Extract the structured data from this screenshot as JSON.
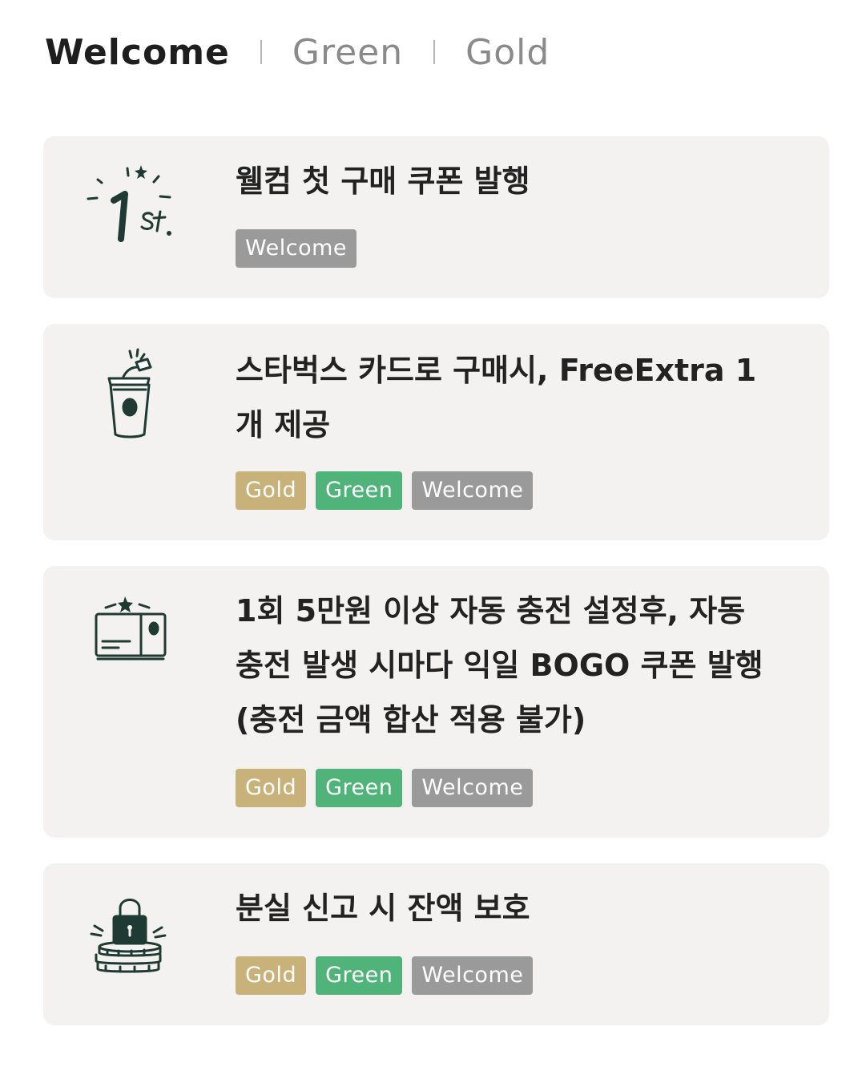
{
  "colors": {
    "gold": "#c8b27a",
    "green": "#4fb37a",
    "welcome": "#9a9a9a",
    "icon": "#1f3a33",
    "card_bg": "#f3f2f1"
  },
  "tabs": [
    {
      "label": "Welcome",
      "active": true
    },
    {
      "label": "Green",
      "active": false
    },
    {
      "label": "Gold",
      "active": false
    }
  ],
  "benefits": [
    {
      "icon": "first-purchase-icon",
      "title": "웰컴 첫 구매 쿠폰 발행",
      "badges": [
        "Welcome"
      ]
    },
    {
      "icon": "cup-extra-icon",
      "title": "스타벅스 카드로 구매시, FreeExtra 1개 제공",
      "badges": [
        "Gold",
        "Green",
        "Welcome"
      ]
    },
    {
      "icon": "card-charge-icon",
      "title": "1회 5만원 이상 자동 충전 설정후, 자동 충전 발생 시마다 익일 BOGO 쿠폰 발행 (충전 금액 합산 적용 불가)",
      "badges": [
        "Gold",
        "Green",
        "Welcome"
      ]
    },
    {
      "icon": "lock-coins-icon",
      "title": "분실 신고 시 잔액 보호",
      "badges": [
        "Gold",
        "Green",
        "Welcome"
      ]
    }
  ]
}
